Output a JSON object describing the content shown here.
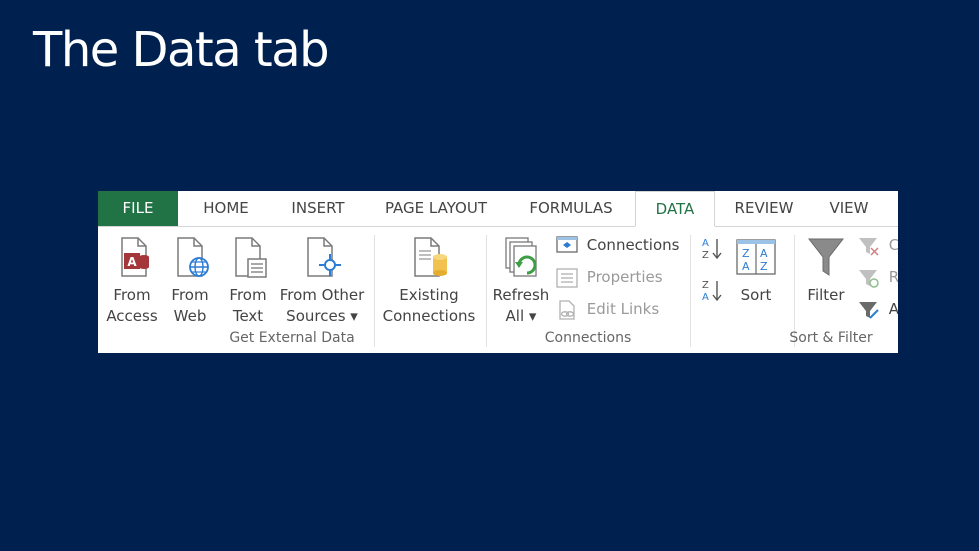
{
  "slide": {
    "title": "The Data tab"
  },
  "tabs": {
    "file": "FILE",
    "home": "HOME",
    "insert": "INSERT",
    "page_layout": "PAGE LAYOUT",
    "formulas": "FORMULAS",
    "data": "DATA",
    "review": "REVIEW",
    "view": "VIEW"
  },
  "get_external_data": {
    "label": "Get External Data",
    "from_access": {
      "line1": "From",
      "line2": "Access"
    },
    "from_web": {
      "line1": "From",
      "line2": "Web"
    },
    "from_text": {
      "line1": "From",
      "line2": "Text"
    },
    "from_other": {
      "line1": "From Other",
      "line2": "Sources ▾"
    },
    "existing": {
      "line1": "Existing",
      "line2": "Connections"
    }
  },
  "connections": {
    "label": "Connections",
    "refresh": {
      "line1": "Refresh",
      "line2": "All ▾"
    },
    "connections_btn": "Connections",
    "properties": "Properties",
    "edit_links": "Edit Links"
  },
  "sort_filter": {
    "label": "Sort & Filter",
    "sort": "Sort",
    "filter": "Filter",
    "clear_partial": "C",
    "reapply_partial": "R",
    "advanced_partial": "A"
  },
  "colors": {
    "background": "#002050",
    "file_tab": "#217346",
    "active_tab_text": "#217346",
    "access_red": "#a4373a",
    "web_blue": "#2b7cd3"
  }
}
